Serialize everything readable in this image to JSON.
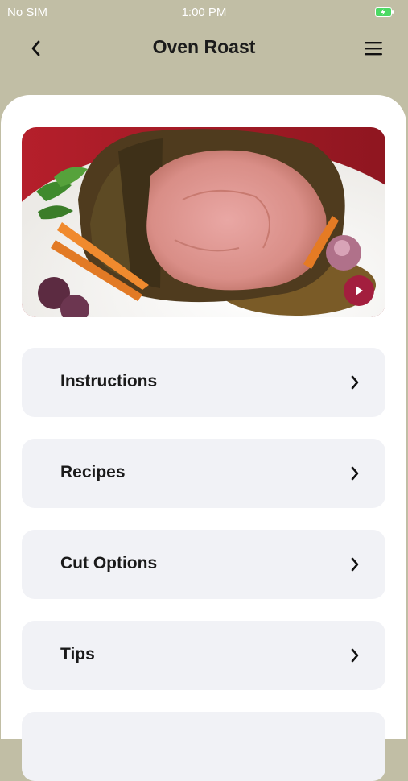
{
  "status_bar": {
    "carrier": "No SIM",
    "time": "1:00 PM",
    "battery_color": "#4cd964"
  },
  "nav": {
    "title": "Oven Roast",
    "back_icon": "chevron-left-icon",
    "menu_icon": "hamburger-menu-icon"
  },
  "hero": {
    "image": "oven-roast-photo",
    "play_icon": "play-icon",
    "play_color": "#a31e3e"
  },
  "menu": {
    "items": [
      {
        "label": "Instructions"
      },
      {
        "label": "Recipes"
      },
      {
        "label": "Cut Options"
      },
      {
        "label": "Tips"
      }
    ],
    "chevron_icon": "chevron-right-icon"
  },
  "colors": {
    "header_bg": "#c1bea5",
    "card_bg": "#f1f2f6",
    "sheet_bg": "#ffffff"
  }
}
